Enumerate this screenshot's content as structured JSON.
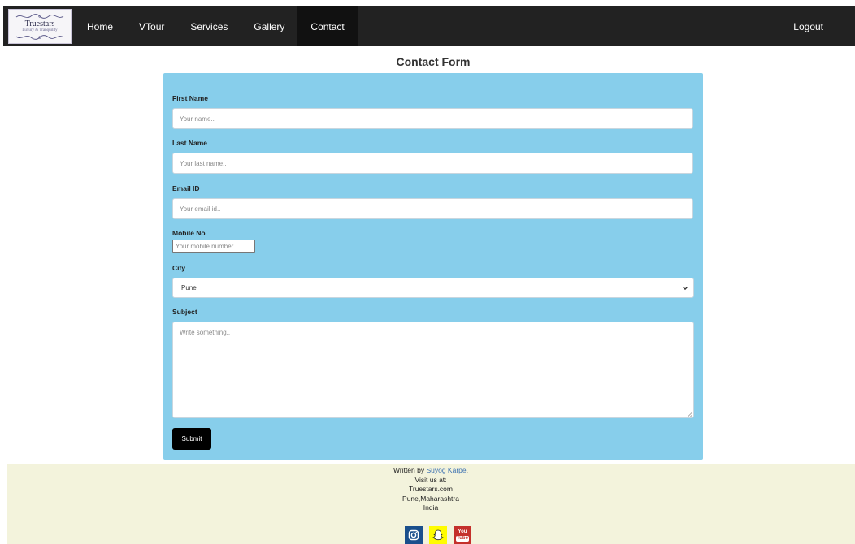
{
  "nav": {
    "logo": {
      "brand": "Truestars",
      "tagline": "Luxury & Tranquility"
    },
    "links": [
      "Home",
      "VTour",
      "Services",
      "Gallery",
      "Contact"
    ],
    "active": "Contact",
    "logout": "Logout"
  },
  "form": {
    "title": "Contact Form",
    "first_name": {
      "label": "First Name",
      "placeholder": "Your name.."
    },
    "last_name": {
      "label": "Last Name",
      "placeholder": "Your last name.."
    },
    "email": {
      "label": "Email ID",
      "placeholder": "Your email id.."
    },
    "mobile": {
      "label": "Mobile No",
      "placeholder": "Your mobile number.."
    },
    "city": {
      "label": "City",
      "value": "Pune"
    },
    "subject": {
      "label": "Subject",
      "placeholder": "Write something.."
    },
    "submit_label": "Submit"
  },
  "footer": {
    "written_by_prefix": "Written by ",
    "author": "Suyog Karpe",
    "written_by_suffix": ".",
    "visit": "Visit us at:",
    "site": "Truestars.com",
    "location": "Pune,Maharashtra",
    "country": "India",
    "social_icons": [
      "instagram-icon",
      "snapchat-icon",
      "youtube-icon"
    ],
    "youtube_text": {
      "top": "You",
      "bottom": "Tube"
    }
  },
  "colors": {
    "nav_bg": "#222222",
    "form_bg": "#87ceeb",
    "footer_bg": "#f3f3dc",
    "submit_bg": "#000000",
    "link": "#3a6fb0"
  }
}
